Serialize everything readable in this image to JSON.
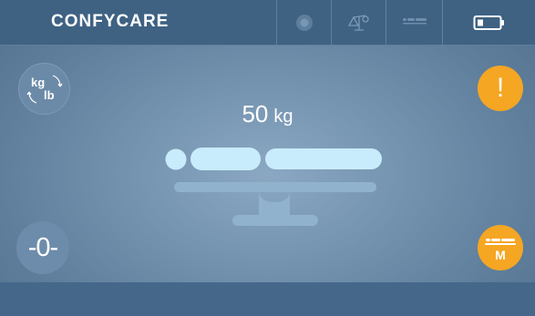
{
  "header": {
    "brand": "CONFYCARE"
  },
  "icons": {
    "record": "record-icon",
    "scale": "scale-icon",
    "bed_mode": "bed-mode-icon",
    "battery": "battery-icon",
    "units_toggle": "units-toggle-icon",
    "alert": "alert-icon",
    "patient": "patient-on-scale-icon",
    "mode": "mode-icon"
  },
  "units_toggle": {
    "from": "kg",
    "to": "lb"
  },
  "display": {
    "weight_value": "50",
    "weight_unit": "kg"
  },
  "controls": {
    "zero_label": "-0-",
    "alert_label": "!",
    "mode_label": "M"
  },
  "colors": {
    "accent": "#f5a623",
    "topbar": "#3f6283",
    "figure": "#c8ecfb"
  }
}
